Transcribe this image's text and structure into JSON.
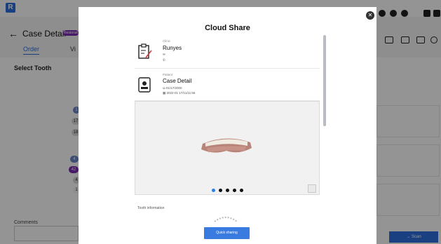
{
  "app": {
    "page_title": "Case Detail",
    "badge": "Restorati",
    "tabs": [
      "Order",
      "Vi"
    ],
    "section_title": "Select Tooth",
    "comments_label": "Comments",
    "next_label": "→ Scan",
    "teeth_visible": [
      "1",
      "17",
      "18",
      "4",
      "42",
      "4",
      "1"
    ]
  },
  "modal": {
    "title": "Cloud Share",
    "close_icon": "close-icon",
    "clinic": {
      "label": "Clinic",
      "name": "Runyes",
      "email_icon": "mail-icon",
      "phone_icon": "phone-icon"
    },
    "patient": {
      "label": "Patient",
      "name": "Case Detail",
      "dob": "01/17/2000",
      "date": "2022-01 17/11/11:56"
    },
    "viewer": {
      "dots_total": 5,
      "active_dot": 0
    },
    "tooth_information_label": "Tooth information",
    "quick_sharing_label": "Quick sharing"
  },
  "colors": {
    "accent": "#3a7be0",
    "badge": "#7a2bb0",
    "overlay": "rgba(0,0,0,0.42)"
  }
}
